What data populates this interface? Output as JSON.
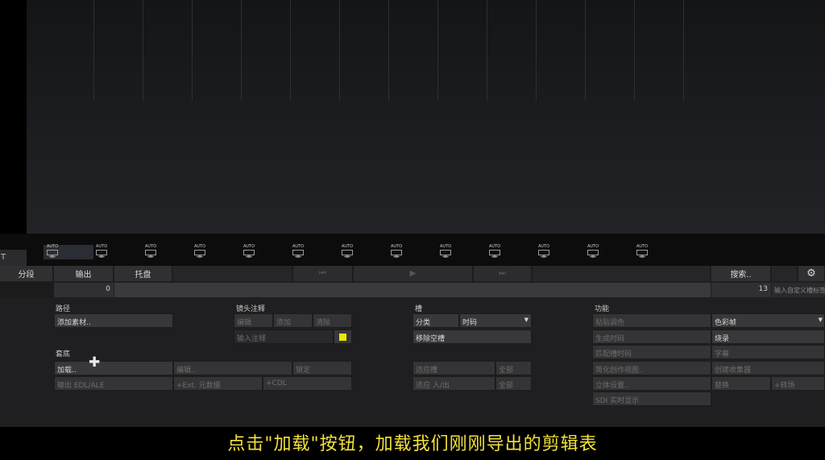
{
  "strip": {
    "left_label": "T",
    "auto_label": "AUTO",
    "auto_arrows": "◄►"
  },
  "tabs": {
    "segment": "分段",
    "output": "输出",
    "tray": "托盘"
  },
  "transport": {
    "prev": "⏮",
    "play": "▶",
    "next": "⏭"
  },
  "search": {
    "label": "搜索..",
    "gear": "⚙"
  },
  "range": {
    "start": "0",
    "end": "13",
    "custom_placeholder": "输入自定义槽标签"
  },
  "path": {
    "title": "路径",
    "add_media": "添加素材.."
  },
  "shot_notes": {
    "title": "镜头注释",
    "edit": "编辑",
    "add": "添加",
    "clear": "清除",
    "input_placeholder": "输入注释",
    "swatch_color": "#e8e800"
  },
  "slots": {
    "title": "槽",
    "classify": "分类",
    "select_value": "时码",
    "remove_empty": "移除空槽",
    "adapt_slot": "适应槽",
    "adapt_inout": "适应 入/出",
    "all": "全部"
  },
  "reel": {
    "title": "套底",
    "load": "加载..",
    "edit": "编辑..",
    "lock": "锁定",
    "export_edl": "输出 EDL/ALE",
    "ext_meta": "+Ext. 元数据",
    "cdl": "+CDL"
  },
  "functions": {
    "title": "功能",
    "paste_grade": "粘贴调色",
    "gen_timecode": "生成时码",
    "match_timecode": "匹配槽时码",
    "simplify_view": "简化创作视图..",
    "stereo_setup": "立体设置..",
    "sdi_live": "SDI 实时显示",
    "color_frame": "色彩帧",
    "burn_in": "烧录",
    "subtitle": "字幕",
    "create_collector": "创建收集器",
    "replace": "替换",
    "plus_transition": "+转场"
  },
  "caption": "点击\"加载\"按钮，加载我们刚刚导出的剪辑表"
}
